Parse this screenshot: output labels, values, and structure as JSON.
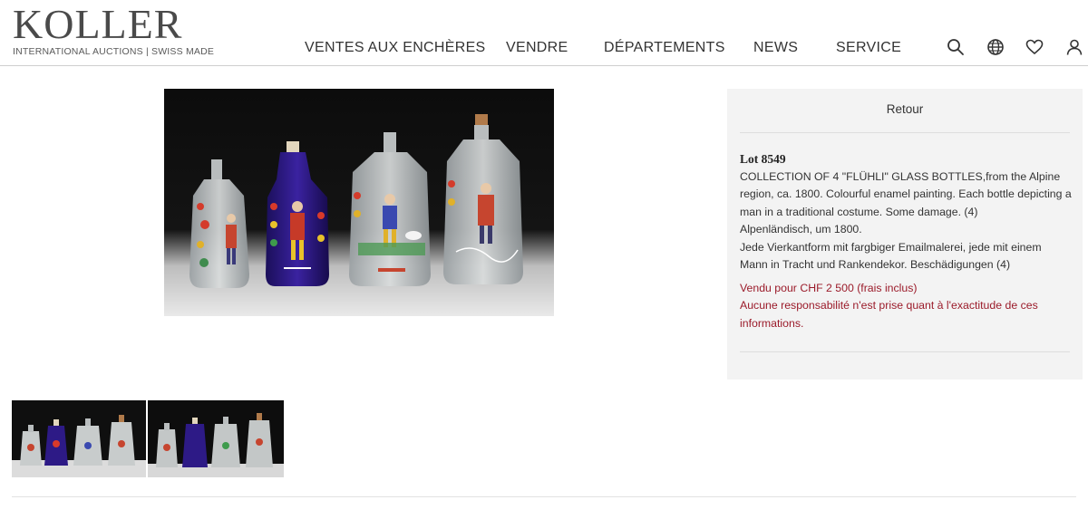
{
  "header": {
    "logo_text": "KOLLER",
    "logo_tagline": "INTERNATIONAL AUCTIONS | SWISS MADE",
    "nav": [
      "VENTES AUX ENCHÈRES",
      "VENDRE",
      "DÉPARTEMENTS",
      "NEWS",
      "SERVICE"
    ],
    "icons": [
      "search-icon",
      "globe-icon",
      "heart-icon",
      "user-icon"
    ]
  },
  "panel": {
    "back_label": "Retour",
    "lot_label": "Lot 8549",
    "description_en": "COLLECTION OF 4 \"FLÜHLI\" GLASS BOTTLES,from the Alpine region, ca. 1800. Colourful enamel painting. Each bottle depicting a man in a traditional costume. Some damage. (4)",
    "description_de_1": "Alpenländisch, um 1800.",
    "description_de_2": "Jede Vierkantform mit fargbiger Emailmalerei, jede mit einem Mann in Tracht und Rankendekor. Beschädigungen (4)",
    "sold_text": "Vendu pour CHF 2 500 (frais inclus)",
    "disclaimer": "Aucune responsabilité n'est prise quant à l'exactitude de ces informations."
  },
  "colors": {
    "accent_red": "#9b1b2a",
    "panel_bg": "#f3f3f3",
    "text": "#333333"
  }
}
